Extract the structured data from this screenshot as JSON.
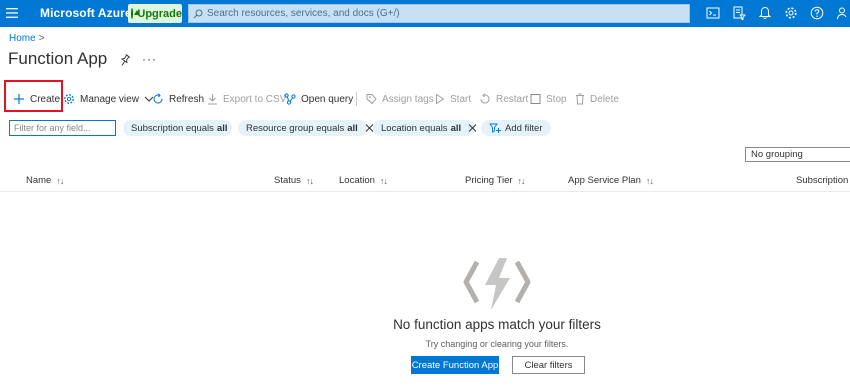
{
  "topbar": {
    "brand": "Microsoft Azure",
    "upgrade_label": "Upgrade",
    "search_placeholder": "Search resources, services, and docs (G+/)",
    "icons": [
      "cloud-shell-icon",
      "directory-filter-icon",
      "notifications-icon",
      "settings-icon",
      "help-icon",
      "feedback-icon"
    ]
  },
  "breadcrumb": {
    "home": "Home",
    "separator": ">"
  },
  "page": {
    "title": "Function App",
    "more": "···"
  },
  "commands": [
    {
      "label": "Create",
      "enabled": true
    },
    {
      "label": "Manage view",
      "enabled": true
    },
    {
      "label": "Refresh",
      "enabled": true
    },
    {
      "label": "Export to CSV",
      "enabled": false
    },
    {
      "label": "Open query",
      "enabled": true
    },
    {
      "label": "Assign tags",
      "enabled": false
    },
    {
      "label": "Start",
      "enabled": false
    },
    {
      "label": "Restart",
      "enabled": false
    },
    {
      "label": "Stop",
      "enabled": false
    },
    {
      "label": "Delete",
      "enabled": false
    }
  ],
  "filters": {
    "placeholder": "Filter for any field...",
    "pills": [
      {
        "prefix": "Subscription equals",
        "value": "all"
      },
      {
        "prefix": "Resource group equals",
        "value": "all"
      },
      {
        "prefix": "Location equals",
        "value": "all"
      }
    ],
    "add_filter": "Add filter"
  },
  "grouping": {
    "value": "No grouping"
  },
  "table": {
    "columns": [
      "Name",
      "Status",
      "Location",
      "Pricing Tier",
      "App Service Plan",
      "Subscription"
    ],
    "sort_glyph": "↑↓"
  },
  "empty_state": {
    "title": "No function apps match your filters",
    "subtitle": "Try changing or clearing your filters.",
    "primary_button": "Create Function App",
    "secondary_button": "Clear filters"
  },
  "colors": {
    "brand": "#0078d4",
    "highlight": "#e81123",
    "upgrade": "#107c10"
  }
}
